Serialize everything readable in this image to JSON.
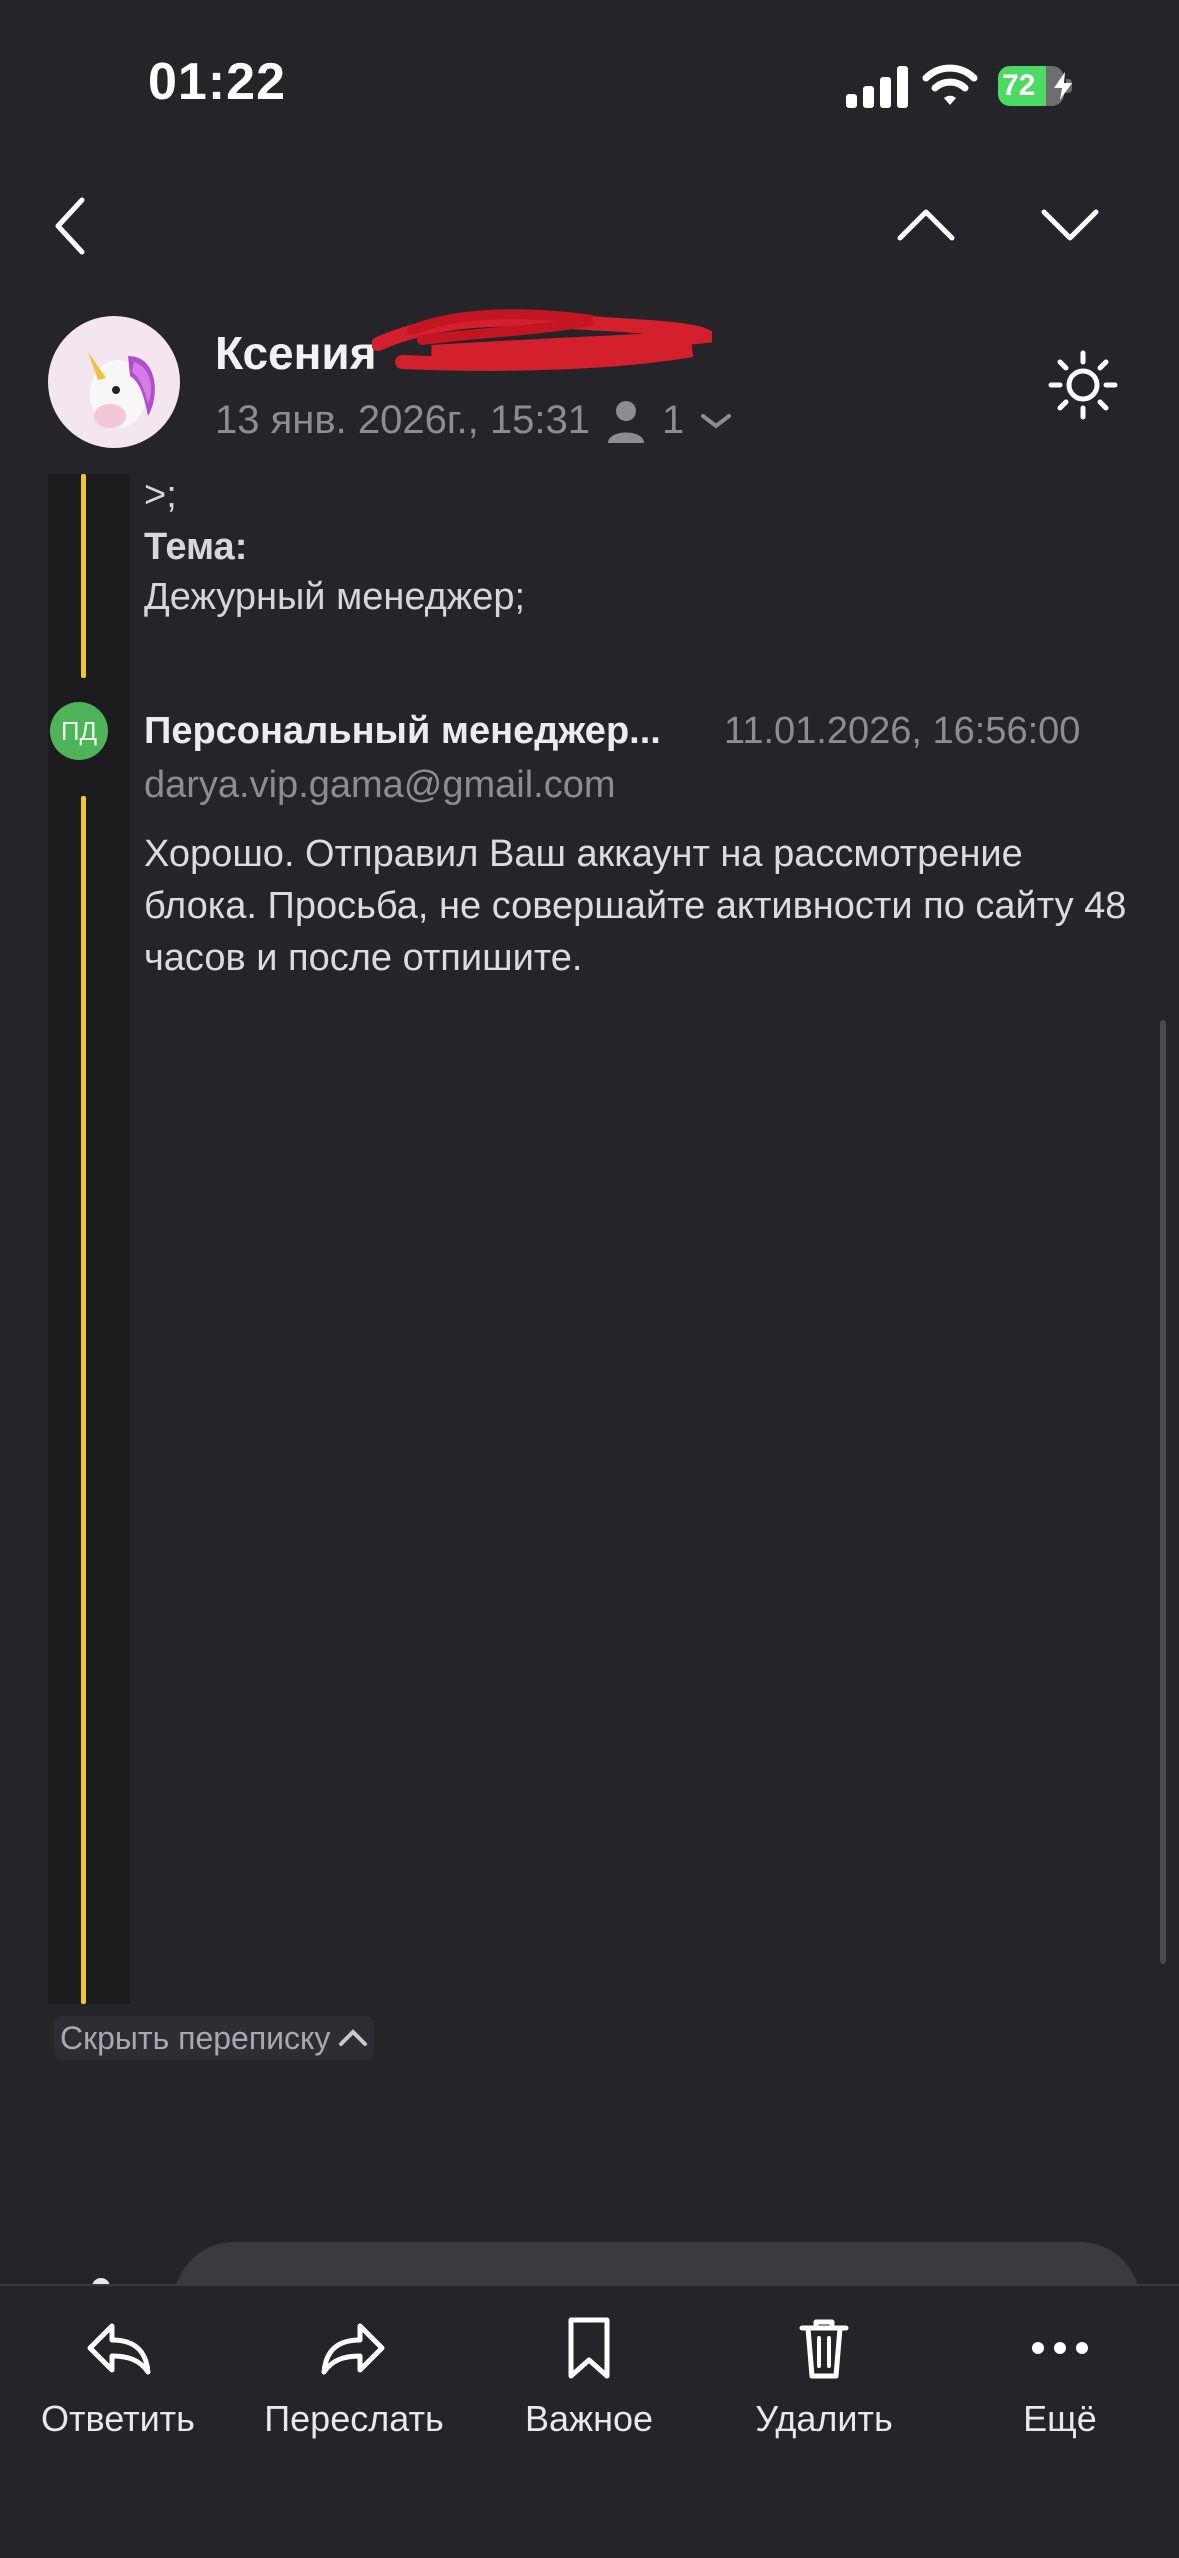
{
  "status_bar": {
    "time": "01:22",
    "battery": "72",
    "battery_level": 0.72
  },
  "header": {
    "sender_name": "Ксения",
    "date": "13 янв. 2026г., 15:31",
    "recipients_count": "1"
  },
  "thread": {
    "quote_prefix": ">;",
    "subject_label": "Тема:",
    "subject_value": "Дежурный менеджер;",
    "message": {
      "initials": "ПД",
      "sender": "Персональный менеджер...",
      "datetime": "11.01.2026, 16:56:00",
      "email": "darya.vip.gama@gmail.com",
      "body": "Хорошо. Отправил Ваш аккаунт на рассмотрение блока. Просьба, не совершайте активности по сайту 48 часов и после отпишите."
    },
    "hide_label": "Скрыть переписку"
  },
  "toolbar": {
    "reply": "Ответить",
    "forward": "Переслать",
    "important": "Важное",
    "delete": "Удалить",
    "more": "Ещё"
  },
  "colors": {
    "accent_line": "#f2c438",
    "background": "#252529",
    "battery": "#4cd964",
    "avatar_initials_bg": "#4fb35a"
  }
}
